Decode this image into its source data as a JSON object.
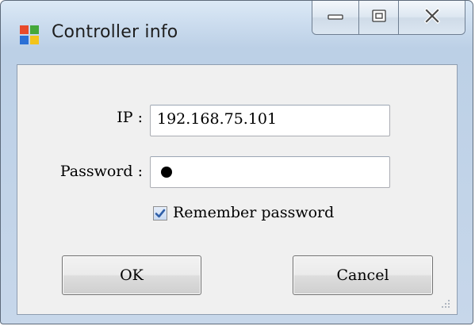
{
  "window": {
    "title": "Controller info",
    "icon": "windows-app-icon"
  },
  "caption_buttons": {
    "minimize_icon": "minimize-icon",
    "maximize_icon": "maximize-icon",
    "close_icon": "close-icon"
  },
  "form": {
    "ip_label": "IP :",
    "ip_value": "192.168.75.101",
    "password_label": "Password :",
    "password_mask": "●",
    "remember_label": "Remember password",
    "remember_checked": true
  },
  "buttons": {
    "ok_label": "OK",
    "cancel_label": "Cancel"
  },
  "colors": {
    "title_gradient_top": "#dce9f6",
    "client_bg": "#f0f0f0",
    "checkbox_check": "#2f5fa8"
  }
}
